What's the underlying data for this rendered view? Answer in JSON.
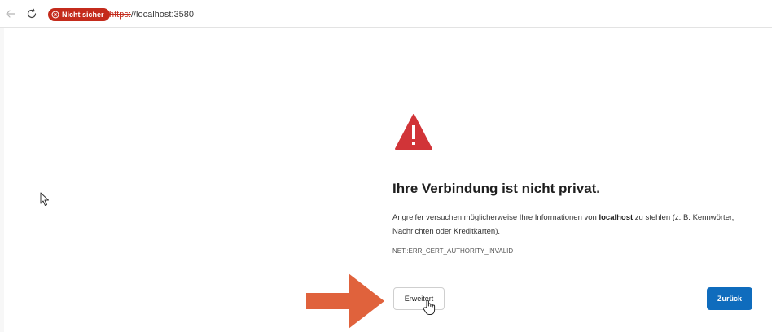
{
  "browser": {
    "security_label": "Nicht sicher",
    "url_scheme": "https:",
    "url_rest": "//localhost:3580"
  },
  "error_page": {
    "title": "Ihre Verbindung ist nicht privat.",
    "desc_before": "Angreifer versuchen möglicherweise Ihre Informationen von ",
    "desc_host": "localhost",
    "desc_after": " zu stehlen (z. B. Kennwörter, Nachrichten oder Kreditkarten).",
    "error_code": "NET::ERR_CERT_AUTHORITY_INVALID",
    "advanced_label": "Erweitert",
    "back_label": "Zurück"
  },
  "colors": {
    "warning_red": "#d13438",
    "annotation_arrow": "#e0623c",
    "primary_button": "#0f6cbd",
    "security_pill": "#c42b1c"
  },
  "icons": {
    "back": "back-arrow-icon",
    "reload": "reload-icon",
    "security": "shield-x-icon",
    "warning": "warning-triangle-icon"
  }
}
